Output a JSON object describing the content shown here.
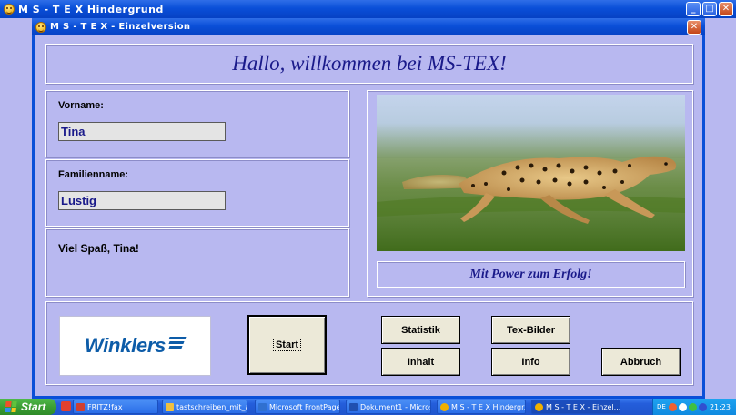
{
  "outer_window": {
    "title": "M S - T E X  Hindergrund",
    "minimize_icon": "minimize-icon",
    "maximize_icon": "maximize-icon",
    "close_icon": "close-icon"
  },
  "inner_window": {
    "title": "M S - T E X   -   Einzelversion",
    "close_label": "✕"
  },
  "welcome": {
    "text": "Hallo, willkommen bei MS-TEX!"
  },
  "form": {
    "first_name": {
      "label": "Vorname:",
      "value": "Tina"
    },
    "last_name": {
      "label": "Familienname:",
      "value": "Lustig"
    },
    "greeting": "Viel Spaß, Tina!"
  },
  "image_panel": {
    "image_icon": "cheetah-photo",
    "slogan": "Mit Power zum Erfolg!"
  },
  "logo": {
    "text": "Winklers"
  },
  "buttons": {
    "start": "Start",
    "statistik": "Statistik",
    "tex_bilder": "Tex-Bilder",
    "inhalt": "Inhalt",
    "info": "Info",
    "abbruch": "Abbruch"
  },
  "taskbar": {
    "start_label": "Start",
    "items": [
      {
        "label": "FRITZ!fax",
        "icon_color": "#d04030"
      },
      {
        "label": "tastschreiben_mit_ab...",
        "icon_color": "#f0c040"
      },
      {
        "label": "Microsoft FrontPage -...",
        "icon_color": "#3070d0"
      },
      {
        "label": "Dokument1 - Microsof...",
        "icon_color": "#2050b0"
      },
      {
        "label": "M S - T E X  Hindergr...",
        "icon_color": "#f0b000"
      },
      {
        "label": "M S - T E X  -  Einzel...",
        "icon_color": "#f0b000"
      }
    ],
    "tray_lang": "DE",
    "clock": "21:23"
  },
  "colors": {
    "title_blue": "#0a4fd8",
    "form_bg": "#b8b8f0",
    "heading_text": "#1a1a8a",
    "logo_blue": "#0d5ca8"
  }
}
